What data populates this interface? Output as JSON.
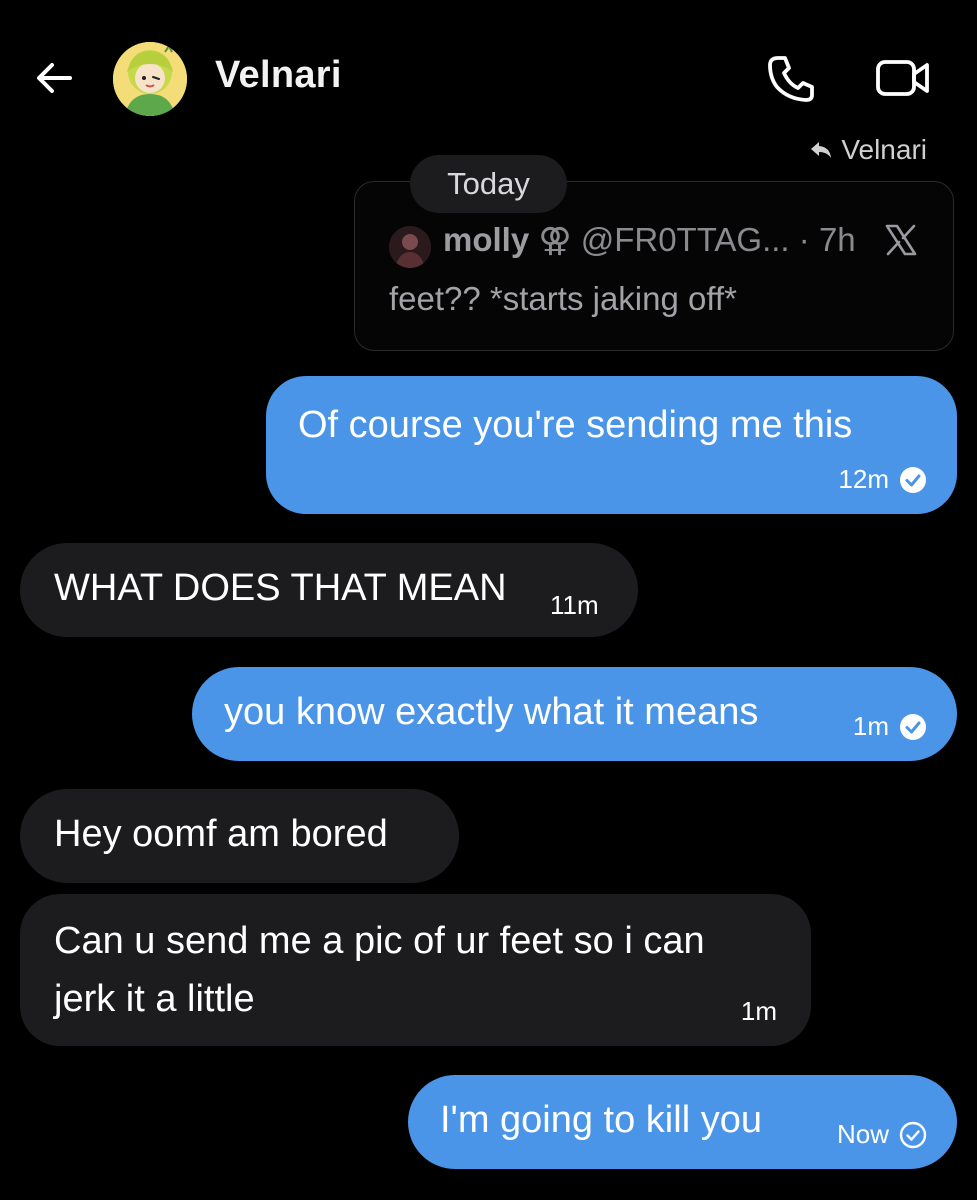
{
  "header": {
    "contact_name": "Velnari"
  },
  "reply": {
    "label": "Velnari"
  },
  "date_divider": "Today",
  "quote": {
    "author": "molly",
    "badge": "⚢",
    "handle": "@FR0TTAG...",
    "age": "· 7h",
    "text": "feet?? *starts jaking off*"
  },
  "messages": [
    {
      "direction": "out",
      "text": "Of course you're sending me this",
      "time": "12m",
      "status": "read"
    },
    {
      "direction": "in",
      "text": "WHAT DOES THAT MEAN",
      "time": "11m"
    },
    {
      "direction": "out",
      "text": "you know exactly what it means",
      "time": "1m",
      "status": "read"
    },
    {
      "direction": "in",
      "text": "Hey oomf am bored"
    },
    {
      "direction": "in",
      "line1": "Can u send me a pic of ur feet so i can",
      "line2": "jerk it a little",
      "time": "1m"
    },
    {
      "direction": "out",
      "text": "I'm going to kill you",
      "time": "Now",
      "status": "sent"
    }
  ],
  "colors": {
    "outgoing_bubble": "#4b95e8",
    "incoming_bubble": "#1c1c1e",
    "background": "#000000"
  }
}
